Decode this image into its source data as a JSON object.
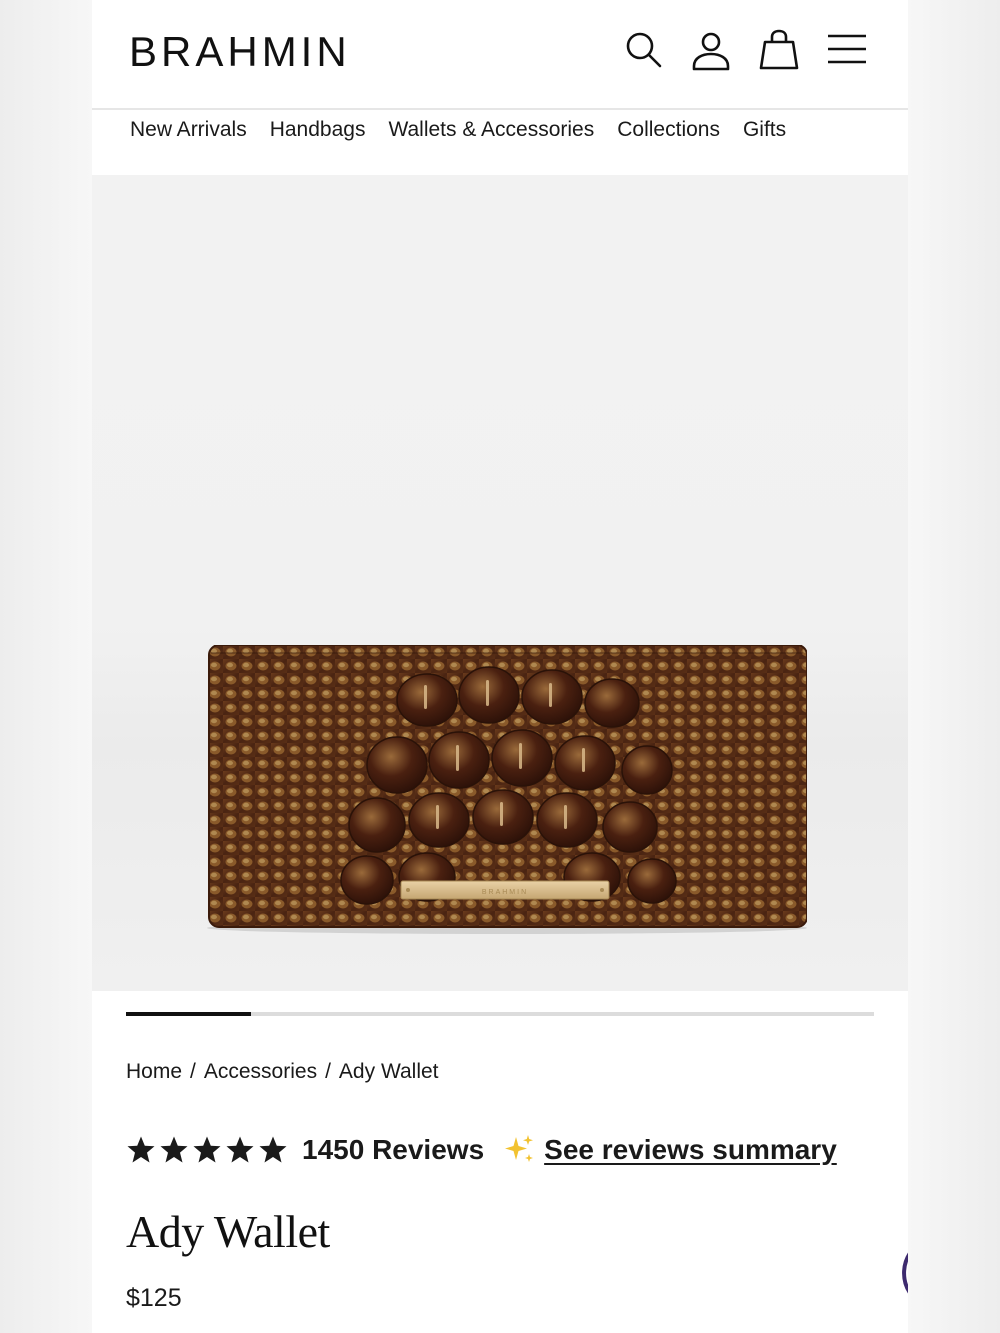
{
  "brand": {
    "logo_text": "BRAHMIN"
  },
  "header_icons": [
    "search-icon",
    "account-icon",
    "shopping-bag-icon",
    "menu-icon"
  ],
  "nav": {
    "items": [
      "New Arrivals",
      "Handbags",
      "Wallets & Accessories",
      "Collections",
      "Gifts"
    ]
  },
  "gallery": {
    "image_alt": "Ady Wallet",
    "carousel_progress": 0.167
  },
  "breadcrumb": {
    "items": [
      "Home",
      "Accessories",
      "Ady Wallet"
    ],
    "separator": "/"
  },
  "rating": {
    "stars": 5,
    "count_label": "1450 Reviews",
    "summary_link": "See reviews summary"
  },
  "product": {
    "name": "Ady Wallet",
    "price": "$125"
  },
  "colors": {
    "accent_sparkle": "#f2c230",
    "cookie_stroke": "#3d2a6e",
    "cookie_dots": "#3ccf8e"
  }
}
